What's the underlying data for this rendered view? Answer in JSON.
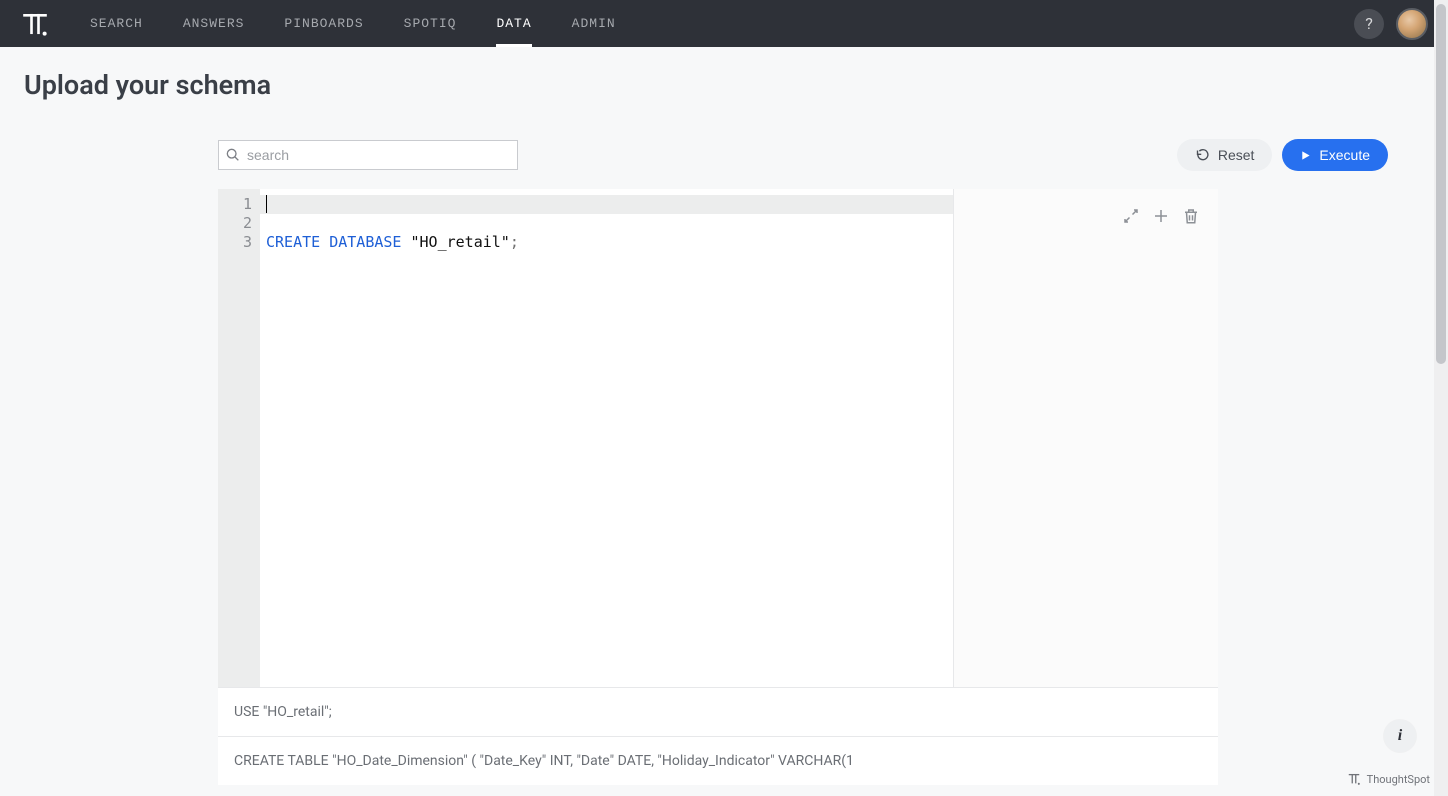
{
  "nav": {
    "items": [
      {
        "label": "SEARCH",
        "active": false
      },
      {
        "label": "ANSWERS",
        "active": false
      },
      {
        "label": "PINBOARDS",
        "active": false
      },
      {
        "label": "SPOTIQ",
        "active": false
      },
      {
        "label": "DATA",
        "active": true
      },
      {
        "label": "ADMIN",
        "active": false
      }
    ]
  },
  "header": {
    "title": "Upload your schema"
  },
  "toolbar": {
    "search_placeholder": "search",
    "reset_label": "Reset",
    "execute_label": "Execute"
  },
  "editor": {
    "line_numbers": [
      "1",
      "2",
      "3"
    ],
    "line2_kw": "CREATE DATABASE",
    "line2_str": " \"HO_retail\"",
    "line2_term": ";"
  },
  "snippets": {
    "s1": "USE \"HO_retail\";",
    "s2": "CREATE TABLE \"HO_Date_Dimension\" ( \"Date_Key\" INT, \"Date\" DATE, \"Holiday_Indicator\" VARCHAR(1"
  },
  "footer": {
    "brand": "ThoughtSpot",
    "help_symbol": "?",
    "info_symbol": "i"
  }
}
